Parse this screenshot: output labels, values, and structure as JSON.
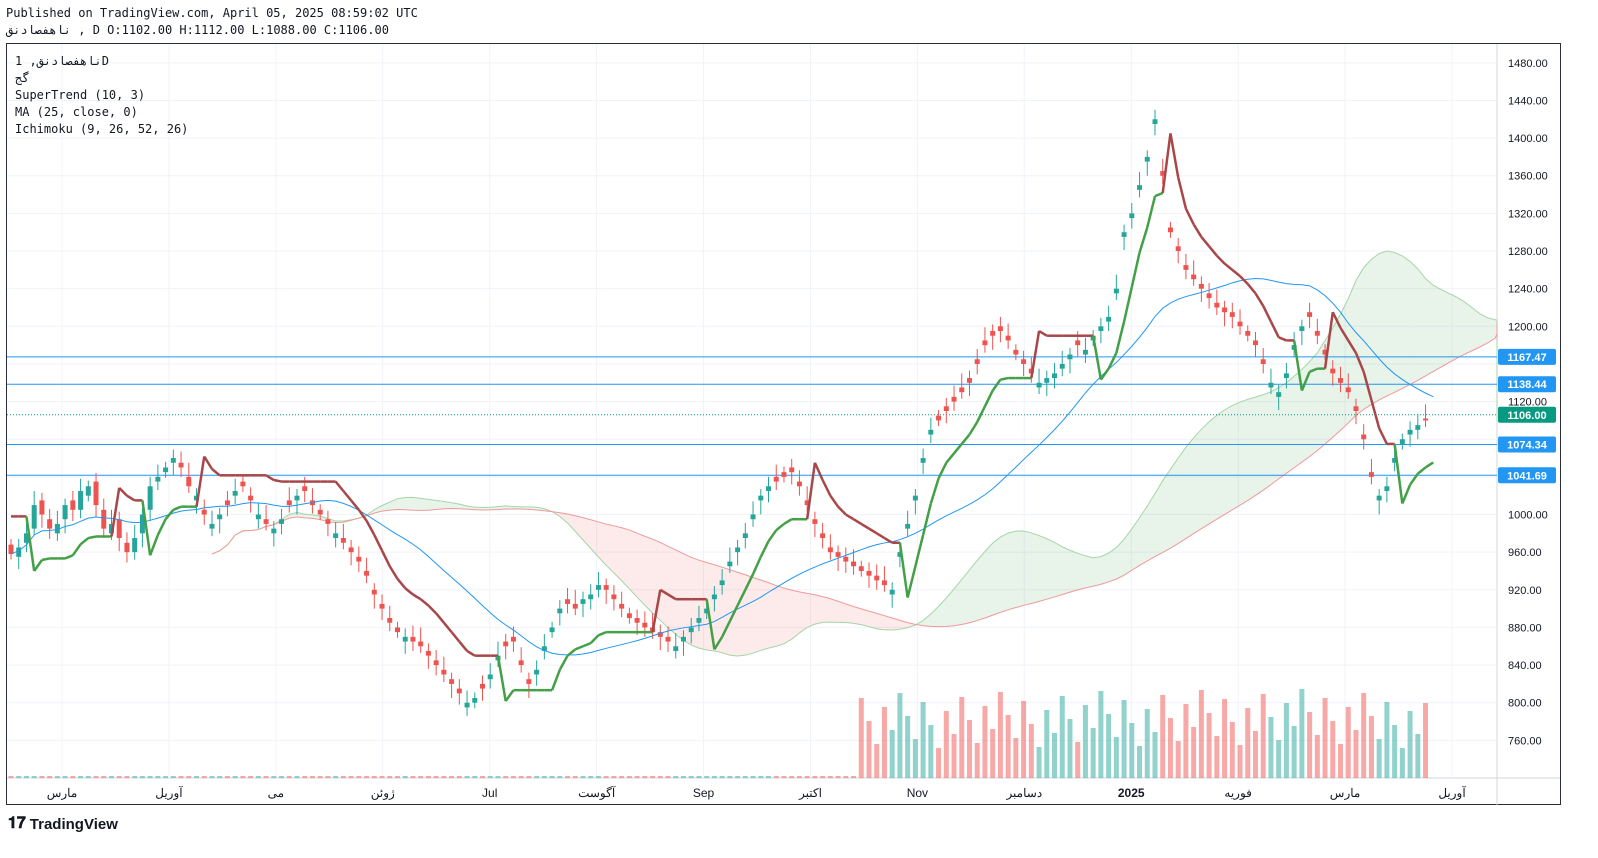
{
  "header": {
    "published": "Published on TradingView.com, April 05, 2025 08:59:02 UTC",
    "ohlc": "ناهفصادنق , D O:1102.00 H:1112.00 L:1088.00 C:1106.00"
  },
  "legend": {
    "symbol": "ناهفصادنق, 1D",
    "sub": "گج",
    "supertrend": "SuperTrend (10, 3)",
    "ma": "MA (25, close, 0)",
    "ichimoku": "Ichimoku (9, 26, 52, 26)"
  },
  "footer": {
    "logo_text": "TradingView"
  },
  "colors": {
    "up": "#26a69a",
    "down": "#ef5350",
    "supertrend_up": "#43a047",
    "supertrend_down": "#a8474a",
    "ma": "#2196f3",
    "hline": "#2196f3",
    "last_price": "#089981"
  },
  "chart_data": {
    "type": "candlestick",
    "y_axis": {
      "min": 720,
      "max": 1500,
      "ticks": [
        760,
        800,
        840,
        880,
        920,
        960,
        1000,
        1040,
        1080,
        1120,
        1160,
        1200,
        1240,
        1280,
        1320,
        1360,
        1400,
        1440,
        1480
      ],
      "tick_labels": [
        "760.00",
        "800.00",
        "840.00",
        "880.00",
        "920.00",
        "960.00",
        "1000.00",
        "",
        "",
        "1120.00",
        "",
        "1200.00",
        "1240.00",
        "1280.00",
        "1320.00",
        "1360.00",
        "1400.00",
        "1440.00",
        "1480.00"
      ]
    },
    "x_axis": {
      "labels": [
        "مارس",
        "آوریل",
        "می",
        "ژوئن",
        "Jul",
        "آگوست",
        "Sep",
        "اکتبر",
        "Nov",
        "دسامبر",
        "2025",
        "فوریه",
        "مارس",
        "آوریل"
      ],
      "bold": [
        "2025"
      ]
    },
    "horizontal_lines": [
      {
        "value": 1167.47,
        "label": "1167.47"
      },
      {
        "value": 1138.44,
        "label": "1138.44"
      },
      {
        "value": 1074.34,
        "label": "1074.34"
      },
      {
        "value": 1041.69,
        "label": "1041.69"
      }
    ],
    "last_price": {
      "value": 1106.0,
      "label": "1106.00"
    },
    "candles_close": [
      958,
      965,
      980,
      1010,
      1000,
      985,
      990,
      1010,
      1005,
      1025,
      1030,
      1010,
      985,
      990,
      975,
      960,
      975,
      1000,
      1030,
      1040,
      1050,
      1060,
      1050,
      1030,
      1020,
      1000,
      990,
      1000,
      1010,
      1025,
      1030,
      1015,
      1000,
      990,
      985,
      995,
      1010,
      1020,
      1025,
      1010,
      1000,
      990,
      980,
      970,
      960,
      950,
      935,
      915,
      900,
      885,
      875,
      870,
      865,
      860,
      850,
      840,
      830,
      820,
      810,
      800,
      805,
      815,
      830,
      850,
      860,
      865,
      840,
      820,
      835,
      860,
      880,
      900,
      905,
      900,
      910,
      915,
      925,
      920,
      910,
      900,
      890,
      885,
      880,
      875,
      870,
      865,
      860,
      870,
      880,
      890,
      900,
      915,
      930,
      950,
      965,
      980,
      1000,
      1020,
      1030,
      1035,
      1040,
      1045,
      1030,
      1010,
      990,
      975,
      960,
      955,
      950,
      945,
      940,
      935,
      930,
      925,
      920,
      960,
      990,
      1020,
      1060,
      1090,
      1100,
      1110,
      1120,
      1130,
      1140,
      1160,
      1180,
      1190,
      1195,
      1185,
      1170,
      1160,
      1150,
      1140,
      1145,
      1150,
      1160,
      1170,
      1180,
      1175,
      1190,
      1200,
      1210,
      1240,
      1300,
      1320,
      1350,
      1380,
      1420,
      1360,
      1300,
      1280,
      1260,
      1250,
      1240,
      1230,
      1220,
      1215,
      1210,
      1200,
      1190,
      1180,
      1160,
      1140,
      1130,
      1150,
      1180,
      1200,
      1210,
      1190,
      1170,
      1150,
      1140,
      1130,
      1110,
      1080,
      1040,
      1020,
      1030,
      1060,
      1080,
      1090,
      1095,
      1100,
      1106
    ],
    "candles_open": [
      968,
      955,
      970,
      985,
      1015,
      995,
      980,
      995,
      1015,
      1005,
      1020,
      1035,
      1005,
      980,
      995,
      970,
      960,
      980,
      1005,
      1035,
      1045,
      1055,
      1055,
      1040,
      1015,
      1005,
      985,
      995,
      1015,
      1020,
      1035,
      1020,
      995,
      995,
      980,
      990,
      1015,
      1015,
      1030,
      1015,
      1005,
      995,
      975,
      975,
      965,
      955,
      940,
      920,
      905,
      890,
      880,
      865,
      870,
      865,
      855,
      845,
      835,
      825,
      815,
      795,
      800,
      820,
      825,
      845,
      865,
      870,
      845,
      825,
      830,
      855,
      875,
      895,
      910,
      905,
      905,
      910,
      920,
      925,
      915,
      905,
      895,
      890,
      885,
      880,
      875,
      870,
      855,
      865,
      875,
      885,
      895,
      910,
      925,
      945,
      960,
      975,
      995,
      1015,
      1025,
      1040,
      1045,
      1050,
      1035,
      1015,
      995,
      980,
      965,
      960,
      955,
      950,
      945,
      940,
      935,
      930,
      915,
      955,
      985,
      1015,
      1055,
      1085,
      1105,
      1115,
      1125,
      1135,
      1145,
      1165,
      1185,
      1195,
      1200,
      1190,
      1175,
      1165,
      1155,
      1135,
      1140,
      1145,
      1155,
      1165,
      1185,
      1170,
      1185,
      1195,
      1205,
      1235,
      1295,
      1315,
      1345,
      1375,
      1415,
      1365,
      1305,
      1285,
      1265,
      1255,
      1245,
      1235,
      1225,
      1220,
      1215,
      1205,
      1195,
      1185,
      1165,
      1135,
      1125,
      1145,
      1175,
      1195,
      1215,
      1195,
      1175,
      1155,
      1145,
      1135,
      1115,
      1085,
      1045,
      1015,
      1025,
      1055,
      1075,
      1085,
      1090,
      1102
    ],
    "volume_note": "daily volume bars (bottom panel)",
    "ichimoku": "cloud shaded green (bullish) / red (bearish)"
  }
}
